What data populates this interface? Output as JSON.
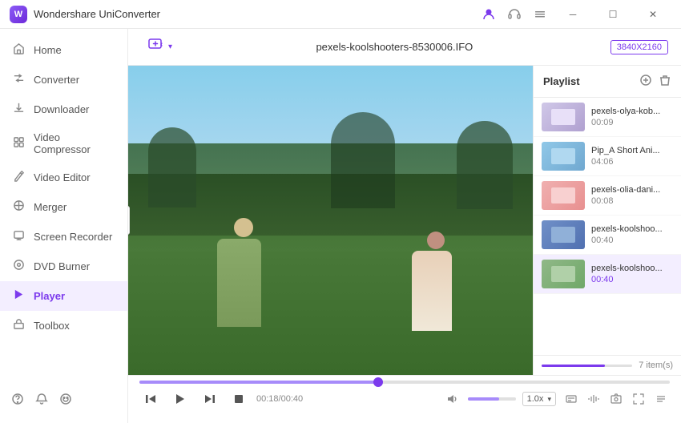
{
  "app": {
    "title": "Wondershare UniConverter",
    "logo_text": "W"
  },
  "title_bar": {
    "icons": [
      "user-icon",
      "headphone-icon",
      "menu-icon"
    ],
    "window_controls": [
      "minimize",
      "maximize",
      "close"
    ]
  },
  "sidebar": {
    "items": [
      {
        "id": "home",
        "label": "Home",
        "icon": "🏠"
      },
      {
        "id": "converter",
        "label": "Converter",
        "icon": "↔"
      },
      {
        "id": "downloader",
        "label": "Downloader",
        "icon": "⬇"
      },
      {
        "id": "video-compressor",
        "label": "Video Compressor",
        "icon": "⊞"
      },
      {
        "id": "video-editor",
        "label": "Video Editor",
        "icon": "✂"
      },
      {
        "id": "merger",
        "label": "Merger",
        "icon": "⊕"
      },
      {
        "id": "screen-recorder",
        "label": "Screen Recorder",
        "icon": "⊡"
      },
      {
        "id": "dvd-burner",
        "label": "DVD Burner",
        "icon": "💿"
      },
      {
        "id": "player",
        "label": "Player",
        "icon": "▶",
        "active": true
      },
      {
        "id": "toolbox",
        "label": "Toolbox",
        "icon": "🔧"
      }
    ],
    "bottom_icons": [
      "question-icon",
      "bell-icon",
      "feedback-icon"
    ]
  },
  "toolbar": {
    "add_label": "",
    "file_name": "pexels-koolshooters-8530006.IFO",
    "resolution": "3840X2160"
  },
  "playlist": {
    "title": "Playlist",
    "items": [
      {
        "id": 1,
        "name": "pexels-olya-kob...",
        "duration": "00:09",
        "thumb_class": "thumb-1",
        "active": false
      },
      {
        "id": 2,
        "name": "Pip_A Short Ani...",
        "duration": "04:06",
        "thumb_class": "thumb-2",
        "active": false
      },
      {
        "id": 3,
        "name": "pexels-olia-dani...",
        "duration": "00:08",
        "thumb_class": "thumb-3",
        "active": false
      },
      {
        "id": 4,
        "name": "pexels-koolshoo...",
        "duration": "00:40",
        "thumb_class": "thumb-4",
        "active": false
      },
      {
        "id": 5,
        "name": "pexels-koolshoo...",
        "duration": "00:40",
        "thumb_class": "thumb-5",
        "active": true
      }
    ],
    "count": "7 item(s)",
    "progress_percent": 70
  },
  "player": {
    "current_time": "00:18/00:40",
    "speed": "1.0x",
    "controls": {
      "prev_label": "⏮",
      "play_label": "▶",
      "next_label": "⏭",
      "stop_label": "⏹"
    }
  }
}
